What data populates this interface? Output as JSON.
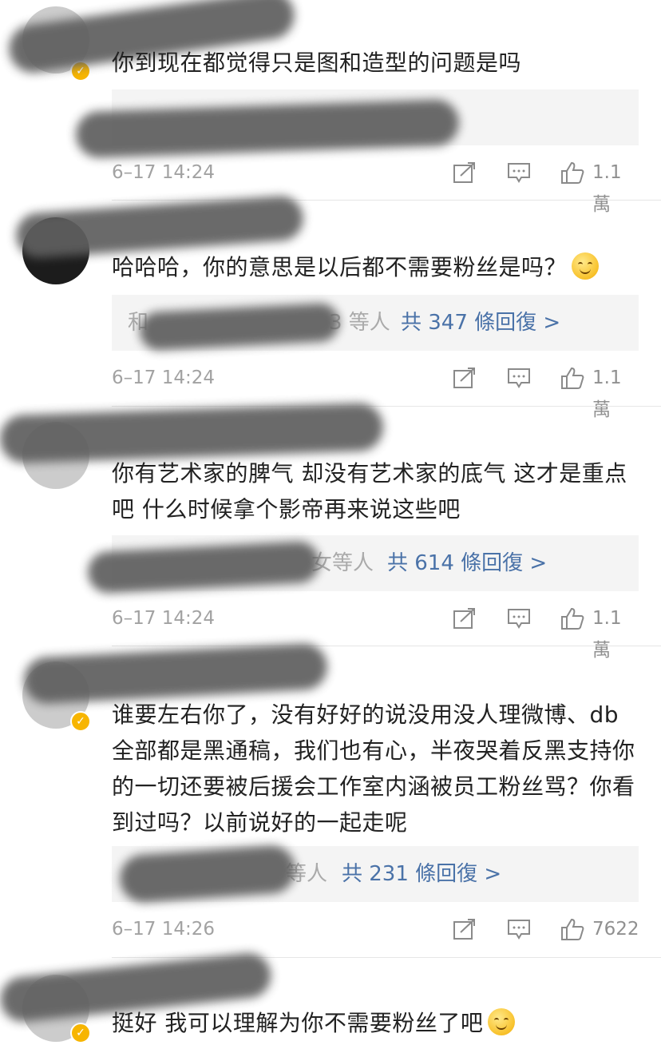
{
  "comments": [
    {
      "text": "你到现在都觉得只是图和造型的问题是吗",
      "time": "6–17 14:24",
      "likes": "1.1萬"
    },
    {
      "text": "哈哈哈，你的意思是以后都不需要粉丝是吗？",
      "emoji": "smile-emoji",
      "replies_prefix": "和",
      "replies_mid": "3 等人",
      "replies_link": "共 347 條回復 >",
      "time": "6–17 14:24",
      "likes": "1.1萬"
    },
    {
      "text": "你有艺术家的脾气 却没有艺术家的底气 这才是重点吧 什么时候拿个影帝再来说这些吧",
      "replies_mid": "女等人",
      "replies_link": "共 614 條回復 >",
      "time": "6–17 14:24",
      "likes": "1.1萬"
    },
    {
      "text": "谁要左右你了，没有好好的说没用没人理微博、db全部都是黑通稿，我们也有心，半夜哭着反黑支持你的一切还要被后援会工作室内涵被员工粉丝骂？你看到过吗？以前说好的一起走呢",
      "replies_mid": "等人",
      "replies_link": "共 231 條回復 >",
      "time": "6–17 14:26",
      "likes": "7622"
    },
    {
      "text": "挺好 我可以理解为你不需要粉丝了吧",
      "emoji": "smile-emoji"
    }
  ],
  "icons": {
    "share": "share-icon",
    "comment": "comment-icon",
    "like": "like-icon",
    "verified": "verified-badge-icon"
  },
  "colors": {
    "link": "#4a72a8",
    "verified": "#f7b500",
    "muted": "#a2a2a2"
  }
}
